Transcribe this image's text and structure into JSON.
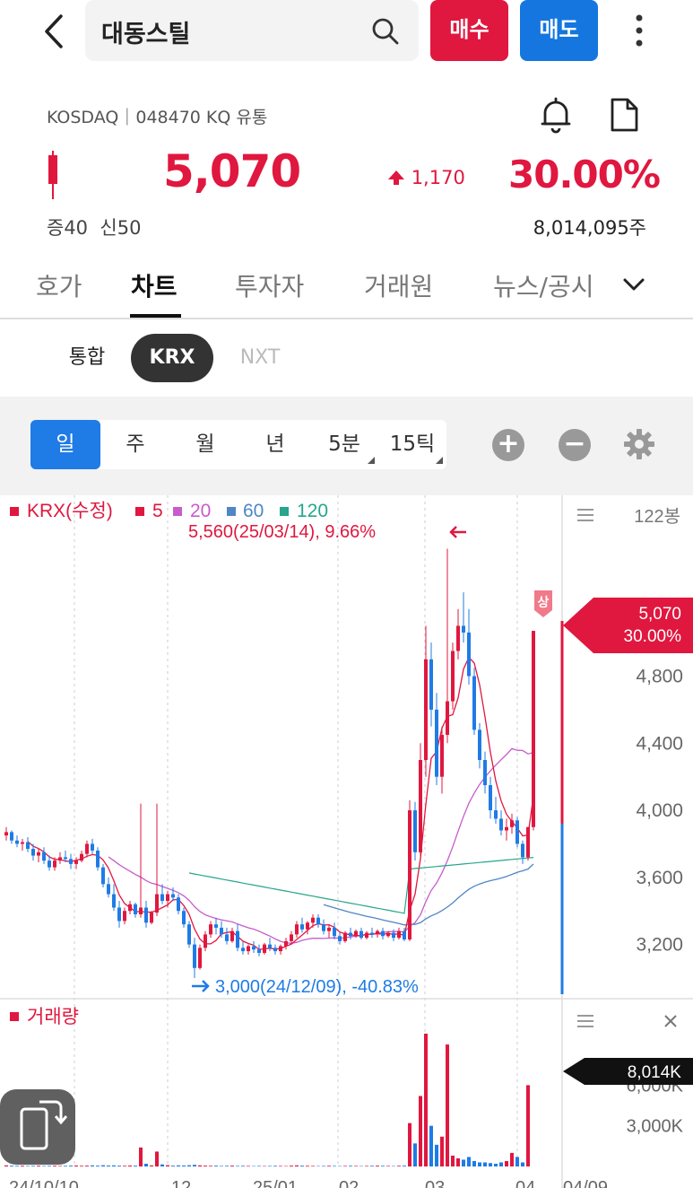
{
  "header": {
    "title": "대동스틸",
    "buy_label": "매수",
    "sell_label": "매도"
  },
  "stock": {
    "market_info": "KOSDAQ｜048470 KQ 유통",
    "price": "5,070",
    "change": "1,170",
    "change_pct": "30.00%",
    "margin": "증40  신50",
    "volume": "8,014,095주"
  },
  "tabs": [
    "호가",
    "차트",
    "투자자",
    "거래원",
    "뉴스/공시"
  ],
  "exchange_tabs": [
    "통합",
    "KRX",
    "NXT"
  ],
  "periods": [
    "일",
    "주",
    "월",
    "년",
    "5분",
    "15틱"
  ],
  "chart_data": {
    "type": "candlestick",
    "legend": {
      "label": "KRX(수정)",
      "ma": [
        {
          "name": "5",
          "color": "#e0173f"
        },
        {
          "name": "20",
          "color": "#c75ccc"
        },
        {
          "name": "60",
          "color": "#4f86c6"
        },
        {
          "name": "120",
          "color": "#26a68a"
        }
      ]
    },
    "bar_count": "122봉",
    "max_annotation": "5,560(25/03/14), 9.66%",
    "min_annotation": "3,000(24/12/09), -40.83%",
    "y_ticks": [
      "4,800",
      "4,400",
      "4,000",
      "3,600",
      "3,200"
    ],
    "ylim": [
      3000,
      5600
    ],
    "current_price_label": "5,070",
    "current_pct_label": "30.00%",
    "upper_limit_badge": "상",
    "volume_title": "거래량",
    "volume_ticks": [
      "6,000K",
      "3,000K"
    ],
    "volume_current": "8,014K",
    "x_ticks": [
      "24/10/10",
      "12",
      "25/01",
      "02",
      "03",
      "04",
      "04/09"
    ],
    "up_color": "#e0173f",
    "down_color": "#1f7be6",
    "ohlc": [
      [
        3850,
        3900,
        3820,
        3870
      ],
      [
        3870,
        3880,
        3800,
        3820
      ],
      [
        3820,
        3850,
        3780,
        3800
      ],
      [
        3800,
        3830,
        3760,
        3810
      ],
      [
        3810,
        3840,
        3750,
        3770
      ],
      [
        3770,
        3800,
        3700,
        3730
      ],
      [
        3730,
        3770,
        3690,
        3750
      ],
      [
        3750,
        3780,
        3680,
        3700
      ],
      [
        3700,
        3730,
        3640,
        3660
      ],
      [
        3660,
        3720,
        3640,
        3700
      ],
      [
        3700,
        3750,
        3680,
        3720
      ],
      [
        3720,
        3760,
        3690,
        3710
      ],
      [
        3710,
        3740,
        3650,
        3680
      ],
      [
        3680,
        3720,
        3650,
        3700
      ],
      [
        3700,
        3760,
        3690,
        3740
      ],
      [
        3740,
        3820,
        3720,
        3800
      ],
      [
        3800,
        3830,
        3740,
        3760
      ],
      [
        3760,
        3780,
        3640,
        3660
      ],
      [
        3660,
        3680,
        3540,
        3560
      ],
      [
        3560,
        3600,
        3480,
        3500
      ],
      [
        3500,
        3560,
        3400,
        3420
      ],
      [
        3420,
        3460,
        3300,
        3340
      ],
      [
        3340,
        3420,
        3320,
        3400
      ],
      [
        3400,
        3460,
        3380,
        3440
      ],
      [
        3440,
        3450,
        3360,
        3380
      ],
      [
        3380,
        4040,
        3360,
        3420
      ],
      [
        3420,
        3460,
        3300,
        3330
      ],
      [
        3330,
        3400,
        3320,
        3390
      ],
      [
        3390,
        4040,
        3370,
        3500
      ],
      [
        3500,
        3560,
        3440,
        3460
      ],
      [
        3460,
        3520,
        3420,
        3500
      ],
      [
        3500,
        3540,
        3460,
        3480
      ],
      [
        3480,
        3500,
        3380,
        3400
      ],
      [
        3400,
        3420,
        3300,
        3320
      ],
      [
        3320,
        3340,
        3180,
        3200
      ],
      [
        3200,
        3240,
        3000,
        3060
      ],
      [
        3060,
        3200,
        3050,
        3180
      ],
      [
        3180,
        3280,
        3160,
        3260
      ],
      [
        3260,
        3340,
        3240,
        3320
      ],
      [
        3320,
        3360,
        3260,
        3300
      ],
      [
        3300,
        3340,
        3240,
        3260
      ],
      [
        3260,
        3300,
        3200,
        3220
      ],
      [
        3220,
        3300,
        3210,
        3280
      ],
      [
        3280,
        3320,
        3160,
        3180
      ],
      [
        3180,
        3220,
        3140,
        3160
      ],
      [
        3160,
        3200,
        3140,
        3190
      ],
      [
        3190,
        3220,
        3150,
        3170
      ],
      [
        3170,
        3200,
        3130,
        3150
      ],
      [
        3150,
        3210,
        3140,
        3200
      ],
      [
        3200,
        3240,
        3160,
        3180
      ],
      [
        3180,
        3200,
        3140,
        3160
      ],
      [
        3160,
        3200,
        3140,
        3190
      ],
      [
        3190,
        3240,
        3170,
        3220
      ],
      [
        3220,
        3280,
        3200,
        3260
      ],
      [
        3260,
        3340,
        3240,
        3320
      ],
      [
        3320,
        3360,
        3270,
        3290
      ],
      [
        3290,
        3340,
        3260,
        3330
      ],
      [
        3330,
        3380,
        3300,
        3360
      ],
      [
        3360,
        3380,
        3300,
        3320
      ],
      [
        3320,
        3350,
        3260,
        3280
      ],
      [
        3280,
        3320,
        3240,
        3300
      ],
      [
        3300,
        3330,
        3230,
        3250
      ],
      [
        3250,
        3270,
        3200,
        3220
      ],
      [
        3220,
        3280,
        3210,
        3270
      ],
      [
        3270,
        3300,
        3230,
        3250
      ],
      [
        3250,
        3290,
        3240,
        3280
      ],
      [
        3280,
        3300,
        3230,
        3240
      ],
      [
        3240,
        3280,
        3230,
        3270
      ],
      [
        3270,
        3300,
        3240,
        3260
      ],
      [
        3260,
        3290,
        3240,
        3280
      ],
      [
        3280,
        3300,
        3230,
        3250
      ],
      [
        3250,
        3280,
        3240,
        3270
      ],
      [
        3270,
        3290,
        3220,
        3240
      ],
      [
        3240,
        3300,
        3230,
        3280
      ],
      [
        3280,
        3300,
        3220,
        3230
      ],
      [
        3230,
        4060,
        3220,
        4000
      ],
      [
        4000,
        4050,
        3700,
        3750
      ],
      [
        3750,
        4400,
        3720,
        4300
      ],
      [
        4300,
        5100,
        4200,
        4900
      ],
      [
        4900,
        5000,
        4500,
        4600
      ],
      [
        4600,
        4700,
        4150,
        4200
      ],
      [
        4200,
        4500,
        4100,
        4450
      ],
      [
        4450,
        5560,
        4400,
        4650
      ],
      [
        4650,
        5000,
        4600,
        4950
      ],
      [
        4950,
        5200,
        4900,
        5100
      ],
      [
        5100,
        5300,
        5000,
        5060
      ],
      [
        5060,
        5200,
        4750,
        4800
      ],
      [
        4800,
        4850,
        4450,
        4480
      ],
      [
        4480,
        4520,
        4250,
        4300
      ],
      [
        4300,
        4350,
        4100,
        4150
      ],
      [
        4150,
        4200,
        3950,
        4000
      ],
      [
        4000,
        4080,
        3920,
        3950
      ],
      [
        3950,
        4000,
        3850,
        3880
      ],
      [
        3880,
        3950,
        3820,
        3900
      ],
      [
        3900,
        3980,
        3860,
        3940
      ],
      [
        3940,
        3960,
        3780,
        3800
      ],
      [
        3800,
        3820,
        3680,
        3720
      ],
      [
        3720,
        3900,
        3700,
        3900
      ],
      [
        3900,
        5070,
        3880,
        5070
      ]
    ],
    "volume_k": [
      80,
      60,
      50,
      60,
      40,
      50,
      60,
      40,
      50,
      60,
      40,
      50,
      60,
      70,
      50,
      60,
      80,
      60,
      90,
      70,
      80,
      60,
      50,
      70,
      60,
      1400,
      200,
      80,
      1100,
      150,
      90,
      60,
      80,
      70,
      90,
      120,
      80,
      60,
      50,
      60,
      40,
      50,
      60,
      40,
      50,
      40,
      30,
      40,
      30,
      40,
      50,
      40,
      30,
      60,
      80,
      60,
      50,
      40,
      30,
      40,
      50,
      40,
      30,
      40,
      50,
      40,
      30,
      40,
      50,
      60,
      50,
      40,
      30,
      50,
      60,
      3200,
      1700,
      5200,
      9800,
      3000,
      1600,
      2200,
      9000,
      800,
      600,
      500,
      700,
      400,
      300,
      300,
      250,
      200,
      300,
      400,
      1000,
      700,
      300,
      6000
    ]
  }
}
